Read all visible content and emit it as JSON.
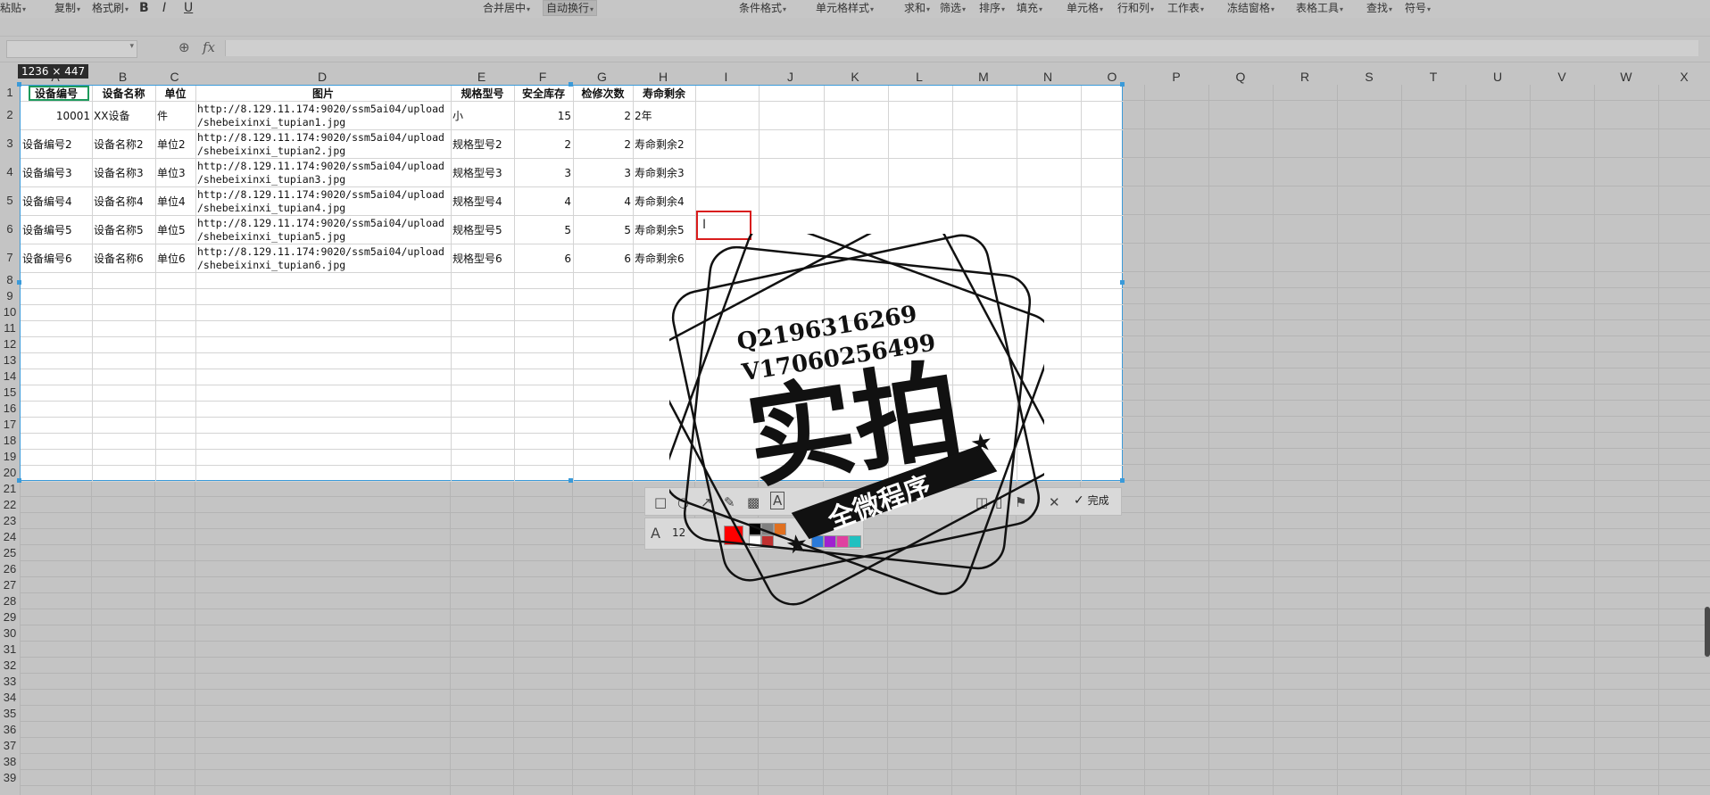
{
  "ribbon": {
    "items": [
      "粘贴",
      "复制",
      "格式刷",
      "B",
      "I",
      "U",
      "合并居中",
      "自动换行",
      "条件格式",
      "单元格样式",
      "求和",
      "筛选",
      "排序",
      "填充",
      "单元格",
      "行和列",
      "工作表",
      "冻结窗格",
      "表格工具",
      "查找",
      "符号"
    ]
  },
  "formula_bar": {
    "name_box": "",
    "fx": "fx",
    "content": ""
  },
  "columns": [
    "A",
    "B",
    "C",
    "D",
    "E",
    "F",
    "G",
    "H",
    "I",
    "J",
    "K",
    "L",
    "M",
    "N",
    "O",
    "P",
    "Q",
    "R",
    "S",
    "T",
    "U",
    "V",
    "W",
    "X"
  ],
  "rows": [
    "1",
    "2",
    "3",
    "4",
    "5",
    "6",
    "7",
    "8",
    "9",
    "10",
    "11",
    "12",
    "13",
    "14",
    "15",
    "16",
    "17",
    "18",
    "19",
    "20",
    "21",
    "22",
    "23",
    "24",
    "25",
    "26",
    "27",
    "28",
    "29",
    "30",
    "31",
    "32",
    "33",
    "34",
    "35",
    "36",
    "37",
    "38",
    "39"
  ],
  "selection_size": "1236 × 447",
  "table": {
    "headers": [
      "设备编号",
      "设备名称",
      "单位",
      "图片",
      "规格型号",
      "安全库存",
      "检修次数",
      "寿命剩余"
    ],
    "rows": [
      [
        "10001",
        "XX设备",
        "件",
        "http://8.129.11.174:9020/ssm5ai04/upload\n/shebeixinxi_tupian1.jpg",
        "小",
        "15",
        "2",
        "2年"
      ],
      [
        "设备编号2",
        "设备名称2",
        "单位2",
        "http://8.129.11.174:9020/ssm5ai04/upload\n/shebeixinxi_tupian2.jpg",
        "规格型号2",
        "2",
        "2",
        "寿命剩余2"
      ],
      [
        "设备编号3",
        "设备名称3",
        "单位3",
        "http://8.129.11.174:9020/ssm5ai04/upload\n/shebeixinxi_tupian3.jpg",
        "规格型号3",
        "3",
        "3",
        "寿命剩余3"
      ],
      [
        "设备编号4",
        "设备名称4",
        "单位4",
        "http://8.129.11.174:9020/ssm5ai04/upload\n/shebeixinxi_tupian4.jpg",
        "规格型号4",
        "4",
        "4",
        "寿命剩余4"
      ],
      [
        "设备编号5",
        "设备名称5",
        "单位5",
        "http://8.129.11.174:9020/ssm5ai04/upload\n/shebeixinxi_tupian5.jpg",
        "规格型号5",
        "5",
        "5",
        "寿命剩余5"
      ],
      [
        "设备编号6",
        "设备名称6",
        "单位6",
        "http://8.129.11.174:9020/ssm5ai04/upload\n/shebeixinxi_tupian6.jpg",
        "规格型号6",
        "6",
        "6",
        "寿命剩余6"
      ]
    ]
  },
  "annotation_toolbar": {
    "tools": [
      "rectangle-icon",
      "ellipse-icon",
      "arrow-icon",
      "pen-icon",
      "mosaic-icon",
      "text-icon",
      "save-icon",
      "pin-icon",
      "cancel-icon"
    ],
    "done_label": "完成",
    "font_size": "12",
    "colors": [
      "#ff0000",
      "#000000",
      "#808080",
      "#ffffff",
      "#c03030",
      "#e07020",
      "#2a7ad9",
      "#a020d0",
      "#e040a0",
      "#20c0c0"
    ]
  },
  "watermark": {
    "line1": "Q2196316269",
    "line2": "V17060256499",
    "big": "实拍",
    "ribbon": "全微程序"
  },
  "colors": {
    "selection": "#3a9ad9",
    "active_cell": "#1e9a5c",
    "annotation_box": "#d91c1c"
  }
}
